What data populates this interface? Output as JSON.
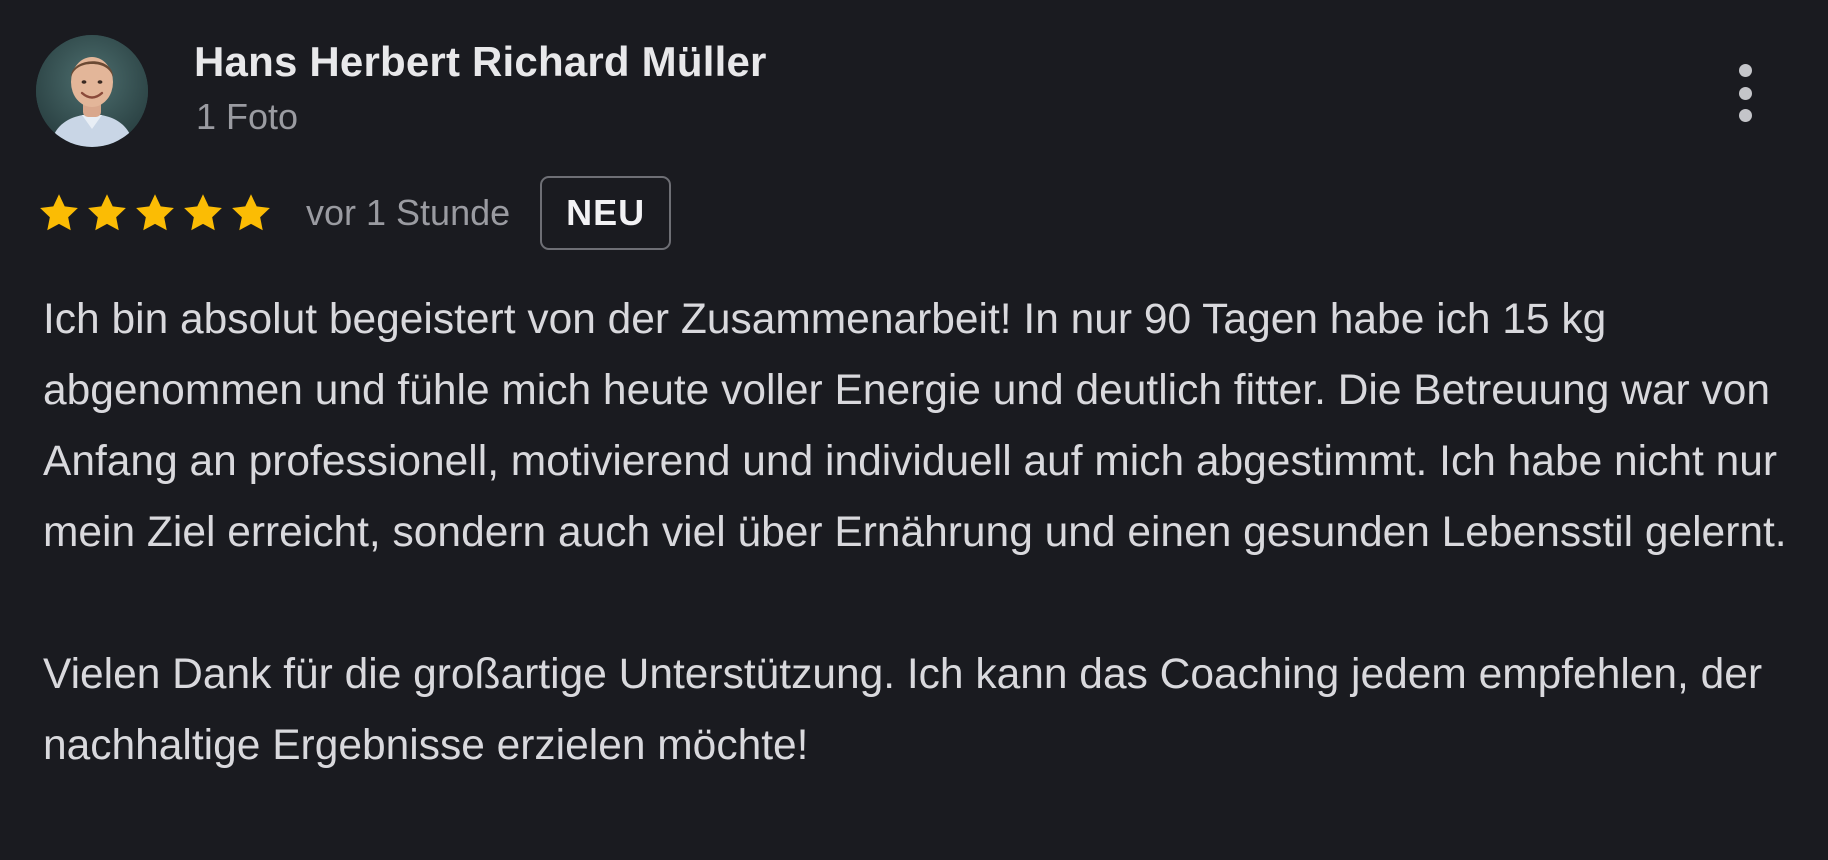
{
  "review": {
    "author": {
      "name": "Hans Herbert Richard Müller",
      "meta": "1 Foto",
      "avatar_icon": "person-photo-avatar"
    },
    "rating": {
      "stars": 5,
      "max_stars": 5,
      "star_color": "#fbbc04"
    },
    "timestamp": "vor 1 Stunde",
    "badge": "NEU",
    "more_icon": "more-vertical-icon",
    "paragraphs": [
      "Ich bin absolut begeistert von der Zusammenarbeit! In nur 90 Tagen habe ich 15 kg abgenommen und fühle mich heute voller Energie und deutlich fitter. Die Betreuung war von Anfang an professionell, motivierend und individuell auf mich abgestimmt. Ich habe nicht nur mein Ziel erreicht, sondern auch viel über Ernährung und einen gesunden Lebensstil gelernt.",
      "Vielen Dank für die großartige Unterstützung. Ich kann das Coaching jedem empfehlen, der nachhaltige Ergebnisse erzielen möchte!"
    ]
  },
  "colors": {
    "background": "#1a1b20",
    "text_primary": "#e8e8ea",
    "text_secondary": "#9a9ba1",
    "body_text": "#d9d9dd"
  }
}
